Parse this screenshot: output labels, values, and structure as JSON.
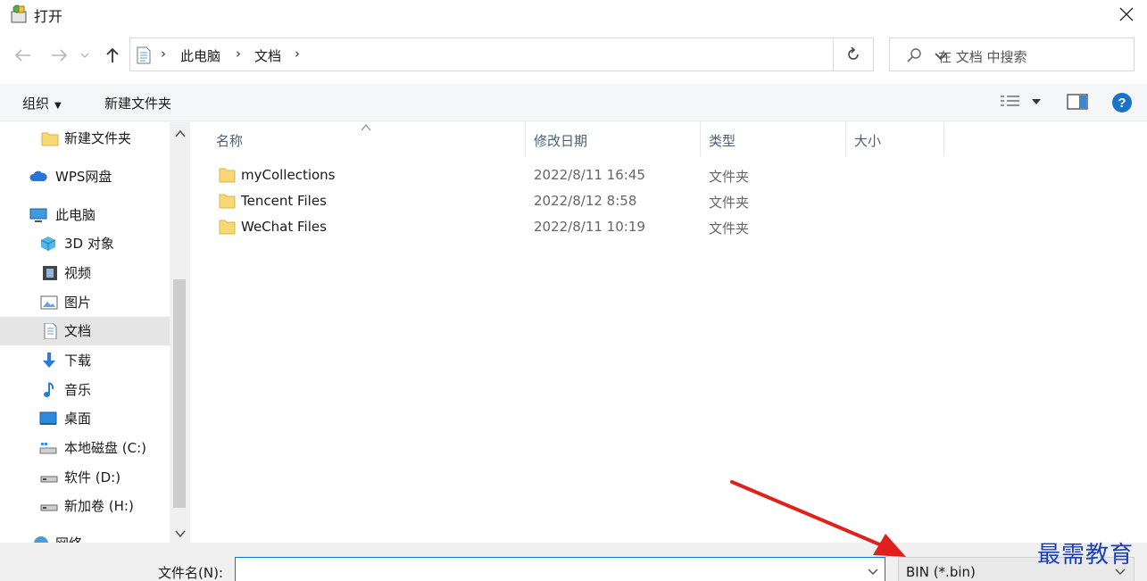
{
  "window": {
    "title": "打开",
    "close_icon": "close-icon"
  },
  "nav": {
    "breadcrumb": [
      "此电脑",
      "文档"
    ],
    "search_placeholder": "在 文档 中搜索"
  },
  "toolbar": {
    "organize": "组织",
    "new_folder": "新建文件夹"
  },
  "sidebar": {
    "items": [
      {
        "label": "新建文件夹",
        "icon": "folder-icon"
      },
      {
        "label": "WPS网盘",
        "icon": "cloud-icon"
      },
      {
        "label": "此电脑",
        "icon": "computer-icon"
      },
      {
        "label": "3D 对象",
        "icon": "cube-icon"
      },
      {
        "label": "视频",
        "icon": "video-icon"
      },
      {
        "label": "图片",
        "icon": "picture-icon"
      },
      {
        "label": "文档",
        "icon": "document-icon",
        "selected": true
      },
      {
        "label": "下载",
        "icon": "download-icon"
      },
      {
        "label": "音乐",
        "icon": "music-icon"
      },
      {
        "label": "桌面",
        "icon": "desktop-icon"
      },
      {
        "label": "本地磁盘 (C:)",
        "icon": "disk-icon"
      },
      {
        "label": "软件 (D:)",
        "icon": "drive-icon"
      },
      {
        "label": "新加卷 (H:)",
        "icon": "drive-icon"
      },
      {
        "label": "网络",
        "icon": "network-icon"
      }
    ]
  },
  "columns": {
    "name": "名称",
    "modified": "修改日期",
    "type": "类型",
    "size": "大小"
  },
  "files": [
    {
      "name": "myCollections",
      "modified": "2022/8/11 16:45",
      "type": "文件夹"
    },
    {
      "name": "Tencent Files",
      "modified": "2022/8/12 8:58",
      "type": "文件夹"
    },
    {
      "name": "WeChat Files",
      "modified": "2022/8/11 10:19",
      "type": "文件夹"
    }
  ],
  "footer": {
    "filename_label": "文件名(N):",
    "filename_value": "",
    "filetype": "BIN (*.bin)"
  },
  "watermark": "最需教育",
  "colors": {
    "accent": "#0078d7",
    "selected": "#e5e5e5",
    "folder": "#f8d775",
    "annotation_arrow": "#e0201b",
    "watermark": "#1c3fb5"
  }
}
